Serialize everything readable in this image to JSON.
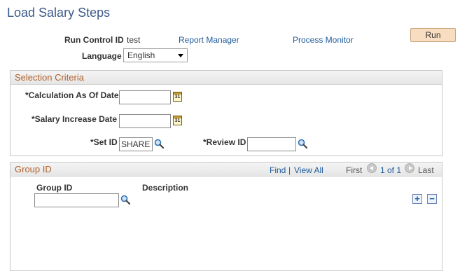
{
  "page": {
    "title": "Load Salary Steps"
  },
  "header": {
    "run_control_label": "Run Control ID",
    "run_control_value": "test",
    "report_manager_link": "Report Manager",
    "process_monitor_link": "Process Monitor",
    "run_button": "Run",
    "language_label": "Language",
    "language_value": "English"
  },
  "selection_criteria": {
    "title": "Selection Criteria",
    "calc_date_label": "*Calculation As Of Date",
    "calc_date_value": "",
    "salary_date_label": "*Salary Increase Date",
    "salary_date_value": "",
    "set_id_label": "*Set ID",
    "set_id_value": "SHARE",
    "review_id_label": "*Review ID",
    "review_id_value": "",
    "calendar_icon_text": "31"
  },
  "group_grid": {
    "title": "Group ID",
    "find_link": "Find",
    "separator": "|",
    "view_all_link": "View All",
    "first_label": "First",
    "pager_text": "1 of 1",
    "last_label": "Last",
    "col_group_id": "Group ID",
    "col_description": "Description",
    "row_group_id_value": "",
    "add_symbol": "+",
    "remove_symbol": "−"
  },
  "icons": {
    "calendar": "calendar-icon",
    "lookup": "magnifier-icon",
    "prev": "arrow-left-icon",
    "next": "arrow-right-icon",
    "dropdown": "chevron-down-icon"
  },
  "colors": {
    "title": "#3c5a8a",
    "section_title": "#b0602a",
    "link": "#1f5b9b",
    "run_button": "#f9ddc0"
  }
}
